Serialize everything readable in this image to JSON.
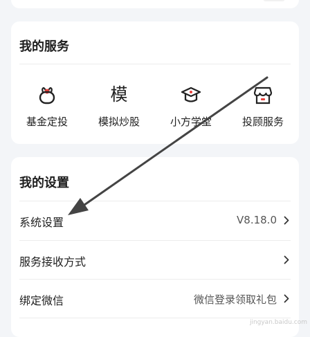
{
  "services": {
    "title": "我的服务",
    "items": [
      {
        "label": "基金定投",
        "icon": "fund-piggy-bag-icon"
      },
      {
        "label": "模拟炒股",
        "icon": "mo-character-icon",
        "glyph": "模"
      },
      {
        "label": "小方学堂",
        "icon": "graduation-cap-icon"
      },
      {
        "label": "投顾服务",
        "icon": "store-icon"
      }
    ]
  },
  "settings": {
    "title": "我的设置",
    "rows": [
      {
        "label": "系统设置",
        "value": "V8.18.0"
      },
      {
        "label": "服务接收方式",
        "value": ""
      },
      {
        "label": "绑定微信",
        "value": "微信登录领取礼包"
      }
    ]
  },
  "watermark": "jingyan.baidu.com",
  "colors": {
    "background": "#f3f5f8",
    "card": "#ffffff",
    "accent_red": "#e8413c",
    "arrow": "#444444"
  }
}
